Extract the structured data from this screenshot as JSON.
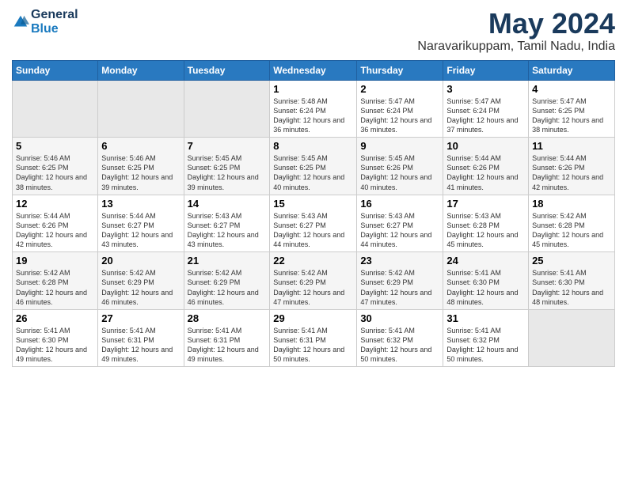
{
  "header": {
    "logo_general": "General",
    "logo_blue": "Blue",
    "month_title": "May 2024",
    "location": "Naravarikuppam, Tamil Nadu, India"
  },
  "weekdays": [
    "Sunday",
    "Monday",
    "Tuesday",
    "Wednesday",
    "Thursday",
    "Friday",
    "Saturday"
  ],
  "weeks": [
    [
      {
        "day": "",
        "empty": true
      },
      {
        "day": "",
        "empty": true
      },
      {
        "day": "",
        "empty": true
      },
      {
        "day": "1",
        "sunrise": "5:48 AM",
        "sunset": "6:24 PM",
        "daylight": "12 hours and 36 minutes."
      },
      {
        "day": "2",
        "sunrise": "5:47 AM",
        "sunset": "6:24 PM",
        "daylight": "12 hours and 36 minutes."
      },
      {
        "day": "3",
        "sunrise": "5:47 AM",
        "sunset": "6:24 PM",
        "daylight": "12 hours and 37 minutes."
      },
      {
        "day": "4",
        "sunrise": "5:47 AM",
        "sunset": "6:25 PM",
        "daylight": "12 hours and 38 minutes."
      }
    ],
    [
      {
        "day": "5",
        "sunrise": "5:46 AM",
        "sunset": "6:25 PM",
        "daylight": "12 hours and 38 minutes."
      },
      {
        "day": "6",
        "sunrise": "5:46 AM",
        "sunset": "6:25 PM",
        "daylight": "12 hours and 39 minutes."
      },
      {
        "day": "7",
        "sunrise": "5:45 AM",
        "sunset": "6:25 PM",
        "daylight": "12 hours and 39 minutes."
      },
      {
        "day": "8",
        "sunrise": "5:45 AM",
        "sunset": "6:25 PM",
        "daylight": "12 hours and 40 minutes."
      },
      {
        "day": "9",
        "sunrise": "5:45 AM",
        "sunset": "6:26 PM",
        "daylight": "12 hours and 40 minutes."
      },
      {
        "day": "10",
        "sunrise": "5:44 AM",
        "sunset": "6:26 PM",
        "daylight": "12 hours and 41 minutes."
      },
      {
        "day": "11",
        "sunrise": "5:44 AM",
        "sunset": "6:26 PM",
        "daylight": "12 hours and 42 minutes."
      }
    ],
    [
      {
        "day": "12",
        "sunrise": "5:44 AM",
        "sunset": "6:26 PM",
        "daylight": "12 hours and 42 minutes."
      },
      {
        "day": "13",
        "sunrise": "5:44 AM",
        "sunset": "6:27 PM",
        "daylight": "12 hours and 43 minutes."
      },
      {
        "day": "14",
        "sunrise": "5:43 AM",
        "sunset": "6:27 PM",
        "daylight": "12 hours and 43 minutes."
      },
      {
        "day": "15",
        "sunrise": "5:43 AM",
        "sunset": "6:27 PM",
        "daylight": "12 hours and 44 minutes."
      },
      {
        "day": "16",
        "sunrise": "5:43 AM",
        "sunset": "6:27 PM",
        "daylight": "12 hours and 44 minutes."
      },
      {
        "day": "17",
        "sunrise": "5:43 AM",
        "sunset": "6:28 PM",
        "daylight": "12 hours and 45 minutes."
      },
      {
        "day": "18",
        "sunrise": "5:42 AM",
        "sunset": "6:28 PM",
        "daylight": "12 hours and 45 minutes."
      }
    ],
    [
      {
        "day": "19",
        "sunrise": "5:42 AM",
        "sunset": "6:28 PM",
        "daylight": "12 hours and 46 minutes."
      },
      {
        "day": "20",
        "sunrise": "5:42 AM",
        "sunset": "6:29 PM",
        "daylight": "12 hours and 46 minutes."
      },
      {
        "day": "21",
        "sunrise": "5:42 AM",
        "sunset": "6:29 PM",
        "daylight": "12 hours and 46 minutes."
      },
      {
        "day": "22",
        "sunrise": "5:42 AM",
        "sunset": "6:29 PM",
        "daylight": "12 hours and 47 minutes."
      },
      {
        "day": "23",
        "sunrise": "5:42 AM",
        "sunset": "6:29 PM",
        "daylight": "12 hours and 47 minutes."
      },
      {
        "day": "24",
        "sunrise": "5:41 AM",
        "sunset": "6:30 PM",
        "daylight": "12 hours and 48 minutes."
      },
      {
        "day": "25",
        "sunrise": "5:41 AM",
        "sunset": "6:30 PM",
        "daylight": "12 hours and 48 minutes."
      }
    ],
    [
      {
        "day": "26",
        "sunrise": "5:41 AM",
        "sunset": "6:30 PM",
        "daylight": "12 hours and 49 minutes."
      },
      {
        "day": "27",
        "sunrise": "5:41 AM",
        "sunset": "6:31 PM",
        "daylight": "12 hours and 49 minutes."
      },
      {
        "day": "28",
        "sunrise": "5:41 AM",
        "sunset": "6:31 PM",
        "daylight": "12 hours and 49 minutes."
      },
      {
        "day": "29",
        "sunrise": "5:41 AM",
        "sunset": "6:31 PM",
        "daylight": "12 hours and 50 minutes."
      },
      {
        "day": "30",
        "sunrise": "5:41 AM",
        "sunset": "6:32 PM",
        "daylight": "12 hours and 50 minutes."
      },
      {
        "day": "31",
        "sunrise": "5:41 AM",
        "sunset": "6:32 PM",
        "daylight": "12 hours and 50 minutes."
      },
      {
        "day": "",
        "empty": true
      }
    ]
  ]
}
